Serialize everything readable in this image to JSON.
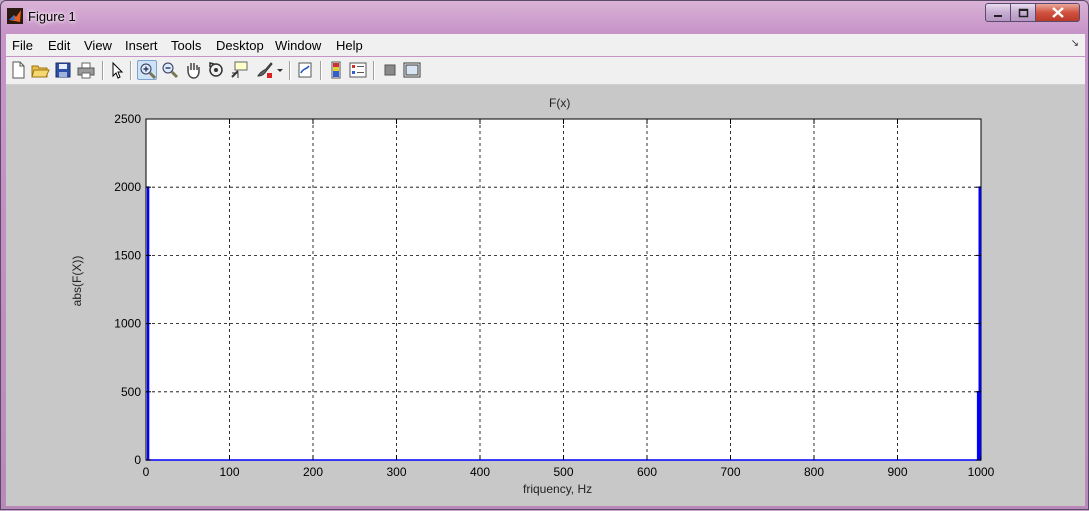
{
  "window": {
    "title": "Figure 1",
    "minimize_icon": "minimize-icon",
    "maximize_icon": "maximize-icon",
    "close_icon": "close-icon"
  },
  "menu": {
    "items": [
      "File",
      "Edit",
      "View",
      "Insert",
      "Tools",
      "Desktop",
      "Window",
      "Help"
    ]
  },
  "toolbar": {
    "buttons": [
      "new-figure-icon",
      "open-file-icon",
      "save-icon",
      "print-icon",
      "edit-plot-arrow-icon",
      "zoom-in-icon",
      "zoom-out-icon",
      "pan-icon",
      "rotate-3d-icon",
      "data-cursor-icon",
      "brush-icon",
      "brush-dropdown-icon",
      "link-plot-icon",
      "insert-colorbar-icon",
      "insert-legend-icon",
      "hide-plot-tools-icon",
      "show-plot-tools-icon"
    ],
    "active": "zoom-in-icon"
  },
  "chart_data": {
    "type": "line",
    "title": "F(x)",
    "xlabel": "friquency, Hz",
    "ylabel": "abs(F(X))",
    "xlim": [
      0,
      1000
    ],
    "ylim": [
      0,
      2500
    ],
    "xticks": [
      "0",
      "100",
      "200",
      "300",
      "400",
      "500",
      "600",
      "700",
      "800",
      "900",
      "1000"
    ],
    "yticks": [
      "0",
      "500",
      "1000",
      "1500",
      "2000",
      "2500"
    ],
    "grid": true,
    "series": [
      {
        "color": "#0000ff",
        "x": [
          0,
          2,
          2,
          3,
          3,
          996,
          996,
          997,
          997,
          998,
          998,
          999,
          999,
          1000
        ],
        "y": [
          0,
          0,
          2000,
          2000,
          0,
          0,
          500,
          500,
          0,
          0,
          2000,
          2000,
          0,
          0
        ]
      }
    ]
  }
}
